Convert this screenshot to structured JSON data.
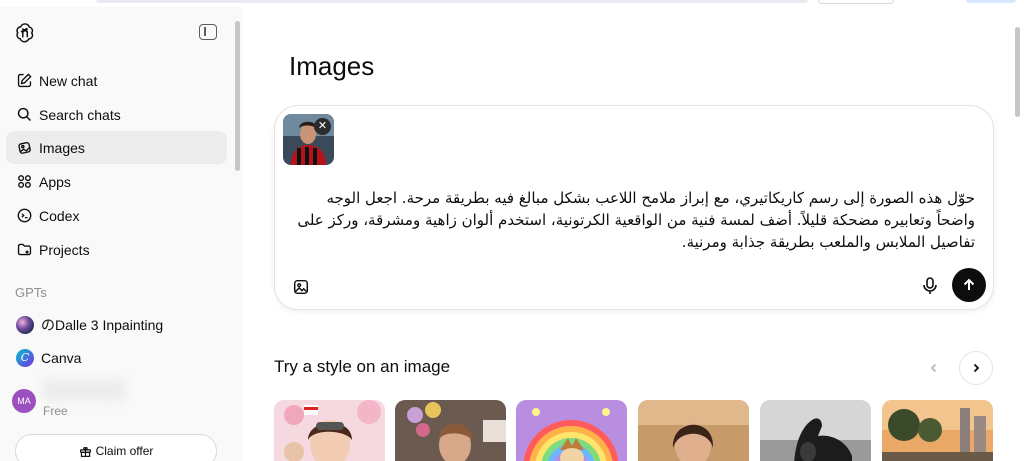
{
  "sidebar": {
    "nav": [
      {
        "label": "New chat",
        "icon": "edit-icon"
      },
      {
        "label": "Search chats",
        "icon": "search-icon"
      },
      {
        "label": "Images",
        "icon": "images-icon"
      },
      {
        "label": "Apps",
        "icon": "apps-icon"
      },
      {
        "label": "Codex",
        "icon": "codex-icon"
      },
      {
        "label": "Projects",
        "icon": "folder-icon"
      }
    ],
    "gpts_heading": "GPTs",
    "gpts": [
      {
        "label": "のDalle 3 Inpainting",
        "icon": "dalle-avatar"
      },
      {
        "label": "Canva",
        "icon": "canva-avatar"
      }
    ],
    "user": {
      "initials": "MA",
      "plan": "Free"
    },
    "claim_label": "Claim offer"
  },
  "main": {
    "title": "Images",
    "composer": {
      "prompt": "حوّل هذه الصورة إلى رسم كاريكاتيري، مع إبراز ملامح اللاعب بشكل مبالغ فيه بطريقة مرحة. اجعل الوجه واضحاً وتعابيره مضحكة قليلاً. أضف لمسة فنية من الواقعية الكرتونية، استخدم ألوان زاهية ومشرقة، وركز على تفاصيل الملابس والملعب بطريقة جذابة ومرنية.",
      "remove_symbol": "✕"
    },
    "styles_title": "Try a style on an image"
  },
  "colors": {
    "accent": "#0d0d0d",
    "sidebar_bg": "#f9f9f9",
    "active_item": "#ececec",
    "avatar": "#9c4fbf"
  }
}
